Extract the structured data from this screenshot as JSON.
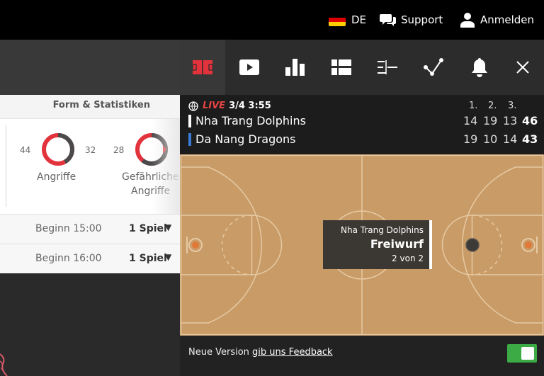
{
  "topbar": {
    "language": "DE",
    "support_label": "Support",
    "login_label": "Anmelden"
  },
  "stats": {
    "header": "Form & Statistiken",
    "stat1": {
      "left": "44",
      "right": "32",
      "label": "Angriffe",
      "home_fraction": 0.42
    },
    "stat2": {
      "left": "28",
      "label_line1": "Gefährliche",
      "label_line2": "Angriffe"
    }
  },
  "matches": [
    {
      "time": "Beginn 15:00",
      "markets": "1 Spiel"
    },
    {
      "time": "Beginn 16:00",
      "markets": "1 Spiel"
    }
  ],
  "panel": {
    "tabs": [
      "court-icon",
      "video-icon",
      "stats-icon",
      "lineup-icon",
      "timeline-icon",
      "trend-icon",
      "bell-icon",
      "close-icon"
    ],
    "status": {
      "live": "LIVE",
      "period": "3/4 3:55"
    },
    "period_headers": [
      "1.",
      "2.",
      "3."
    ],
    "teams": [
      {
        "name": "Nha Trang Dolphins",
        "color": "#ffffff",
        "q": [
          "14",
          "19",
          "13"
        ],
        "total": "46"
      },
      {
        "name": "Da Nang Dragons",
        "color": "#3a7bd5",
        "q": [
          "19",
          "10",
          "14"
        ],
        "total": "43"
      }
    ],
    "event": {
      "team": "Nha Trang Dolphins",
      "type": "Freiwurf",
      "count": "2 von 2"
    },
    "footer": {
      "text": "Neue Version",
      "link": "gib uns Feedback"
    }
  },
  "colors": {
    "accent_red": "#e2333d",
    "live_red": "#e74343",
    "toggle_green": "#3cab46",
    "court": "#c99b66"
  }
}
